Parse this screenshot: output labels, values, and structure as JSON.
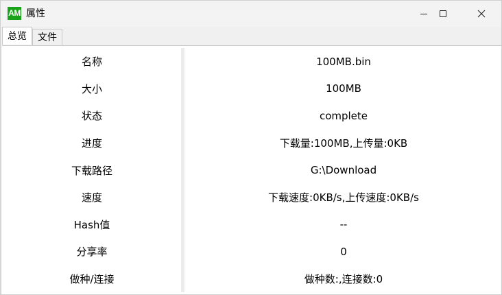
{
  "window": {
    "app_icon_text": "AM",
    "title": "属性"
  },
  "tabs": [
    {
      "label": "总览",
      "active": true
    },
    {
      "label": "文件",
      "active": false
    }
  ],
  "properties": [
    {
      "label": "名称",
      "value": "100MB.bin"
    },
    {
      "label": "大小",
      "value": "100MB"
    },
    {
      "label": "状态",
      "value": "complete"
    },
    {
      "label": "进度",
      "value": "下载量:100MB,上传量:0KB"
    },
    {
      "label": "下载路径",
      "value": "G:\\Download"
    },
    {
      "label": "速度",
      "value": "下载速度:0KB/s,上传速度:0KB/s"
    },
    {
      "label": "Hash值",
      "value": "--"
    },
    {
      "label": "分享率",
      "value": "0"
    },
    {
      "label": "做种/连接",
      "value": "做种数:,连接数:0"
    }
  ]
}
